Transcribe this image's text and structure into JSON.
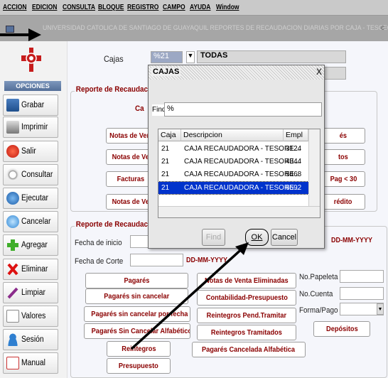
{
  "menu": {
    "accion": "ACCION",
    "edicion": "EDICION",
    "consulta": "CONSULTA",
    "bloque": "BLOQUE",
    "registro": "REGISTRO",
    "campo": "CAMPO",
    "ayuda": "AYUDA",
    "window": "Window"
  },
  "title": {
    "text": "UNIVERSIDAD CATOLICA DE SANTIAGO DE GUAYAQUIL   REPORTES DE RECAUDACION DIARIAS POR CAJA - TESCE01F",
    "right": "c"
  },
  "sidebar": {
    "header": "OPCIONES",
    "items": [
      {
        "label": "Grabar",
        "icon": "save-icon"
      },
      {
        "label": "Imprimir",
        "icon": "printer-icon"
      },
      {
        "label": "Salir",
        "icon": "power-icon"
      },
      {
        "label": "Consultar",
        "icon": "search-icon"
      },
      {
        "label": "Ejecutar",
        "icon": "execute-icon"
      },
      {
        "label": "Cancelar",
        "icon": "cancel-icon"
      },
      {
        "label": "Agregar",
        "icon": "add-icon"
      },
      {
        "label": "Eliminar",
        "icon": "delete-icon"
      },
      {
        "label": "Limpiar",
        "icon": "clear-icon"
      },
      {
        "label": "Valores",
        "icon": "values-icon"
      },
      {
        "label": "Sesión",
        "icon": "session-icon"
      },
      {
        "label": "Manual",
        "icon": "manual-icon"
      }
    ]
  },
  "form": {
    "cajas_label": "Cajas",
    "cajas_code": "%21",
    "cajas_desc": "TODAS",
    "group1_title": "Reporte de Recaudacion",
    "group1_field_label": "Ca",
    "group2_title": "Reporte de Recaudacione",
    "g1_buttons": {
      "notas_vent": "Notas de Vent",
      "notas_ve": "Notas de Ve",
      "facturas": "Facturas",
      "notas_ve2": "Notas de Ve",
      "es": "és",
      "tos": "tos",
      "pag30": "Pag < 30",
      "credito": "rédito"
    },
    "fecha_inicio_label": "Fecha de inicio",
    "fecha_corte_label": "Fecha de Corte",
    "date_fmt1": "DD-MM-YYYY",
    "date_fmt2": "DD-MM-YYYY",
    "g2_buttons": {
      "pagares": "Pagarés",
      "pagares_sin_cancelar": "Pagarés sin cancelar",
      "pagares_sin_cancelar_fecha": "Pagarés sin cancelar por fecha",
      "pagares_sin_cancelar_alfabetico": "Pagarés Sin Cancelar Alfabético",
      "reintegros": "Reintegros",
      "presupuesto": "Presupuesto",
      "notas_venta_eliminadas": "Notas de Venta Eliminadas",
      "contabilidad_presupuesto": "Contabilidad-Presupuesto",
      "reintegros_pend": "Reintegros Pend.Tramitar",
      "reintegros_tramitados": "Reintegros Tramitados",
      "pagares_cancelada_alfabetica": "Pagarés Cancelada Alfabética",
      "depositos": "Depósitos"
    },
    "no_papeleta_label": "No.Papeleta",
    "no_cuenta_label": "No.Cuenta",
    "forma_pago_label": "Forma/Pago"
  },
  "dialog": {
    "title": "CAJAS",
    "close": "X",
    "find_label": "Find",
    "find_value": "%",
    "columns": [
      "Caja",
      "Descripcion",
      "Empl"
    ],
    "rows": [
      {
        "caja": "21",
        "desc": "CAJA RECAUDADORA - TESORE...",
        "empl": "3124"
      },
      {
        "caja": "21",
        "desc": "CAJA RECAUDADORA - TESORE...",
        "empl": "4344"
      },
      {
        "caja": "21",
        "desc": "CAJA RECAUDADORA - TESORE...",
        "empl": "5468"
      },
      {
        "caja": "21",
        "desc": "CAJA RECAUDADORA - TESORE...",
        "empl": "6592"
      }
    ],
    "buttons": {
      "find": "Find",
      "ok": "OK",
      "cancel": "Cancel"
    }
  },
  "colors": {
    "accent_red": "#8a0000",
    "selection": "#0033cc",
    "sidebar_header": "#5f7aa3"
  }
}
